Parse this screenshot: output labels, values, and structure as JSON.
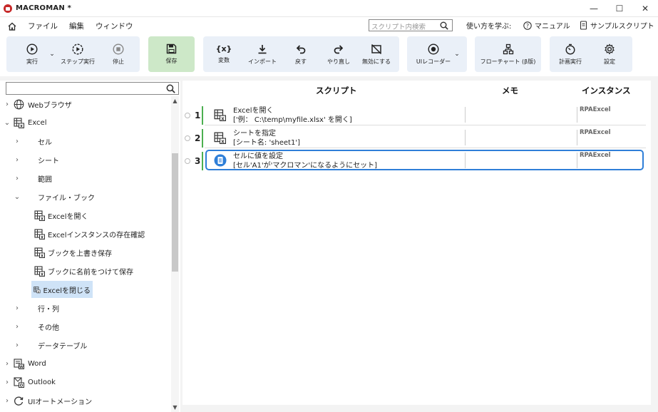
{
  "app": {
    "title": "MACROMAN *",
    "accent": "#2f7fd8"
  },
  "window": {
    "minimize": "—",
    "maximize": "☐",
    "close": "✕"
  },
  "menu": [
    "ファイル",
    "編集",
    "ウィンドウ"
  ],
  "script_search": {
    "placeholder": "スクリプト内検索"
  },
  "help": {
    "learn": "使い方を学ぶ:",
    "manual": "マニュアル",
    "sample": "サンプルスクリプト"
  },
  "toolbar": {
    "run": "実行",
    "step": "ステップ実行",
    "stop": "停止",
    "save": "保存",
    "variables": "変数",
    "import": "インポート",
    "undo": "戻す",
    "redo": "やり直し",
    "disable": "無効にする",
    "ui_recorder": "UIレコーダー",
    "flowchart": "フローチャート (β版)",
    "schedule": "計画実行",
    "settings": "設定",
    "var_glyph": "{x}"
  },
  "tree": [
    {
      "label": "Webブラウザ",
      "chev": "›"
    },
    {
      "label": "Excel",
      "chev": "⌄"
    },
    {
      "label": "セル",
      "chev": "›"
    },
    {
      "label": "シート",
      "chev": "›"
    },
    {
      "label": "範囲",
      "chev": "›"
    },
    {
      "label": "ファイル・ブック",
      "chev": "⌄"
    },
    {
      "label": "Excelを開く"
    },
    {
      "label": "Excelインスタンスの存在確認"
    },
    {
      "label": "ブックを上書き保存"
    },
    {
      "label": "ブックに名前をつけて保存"
    },
    {
      "label": "Excelを閉じる"
    },
    {
      "label": "行・列",
      "chev": "›"
    },
    {
      "label": "その他",
      "chev": "›"
    },
    {
      "label": "データテーブル",
      "chev": "›"
    },
    {
      "label": "Word",
      "chev": "›"
    },
    {
      "label": "Outlook",
      "chev": "›"
    },
    {
      "label": "UIオートメーション",
      "chev": "›"
    }
  ],
  "headers": {
    "script": "スクリプト",
    "memo": "メモ",
    "instance": "インスタンス"
  },
  "rows": [
    {
      "num": "1",
      "title": "Excelを開く",
      "detail": "['例： C:\\temp\\myfile.xlsx' を開く]",
      "instance": "RPAExcel"
    },
    {
      "num": "2",
      "title": "シートを指定",
      "detail": "[シート名: 'sheet1']",
      "instance": "RPAExcel"
    },
    {
      "num": "3",
      "title": "セルに値を設定",
      "detail": "[セル'A1'が'マクロマン'になるようにセット]",
      "instance": "RPAExcel"
    }
  ]
}
